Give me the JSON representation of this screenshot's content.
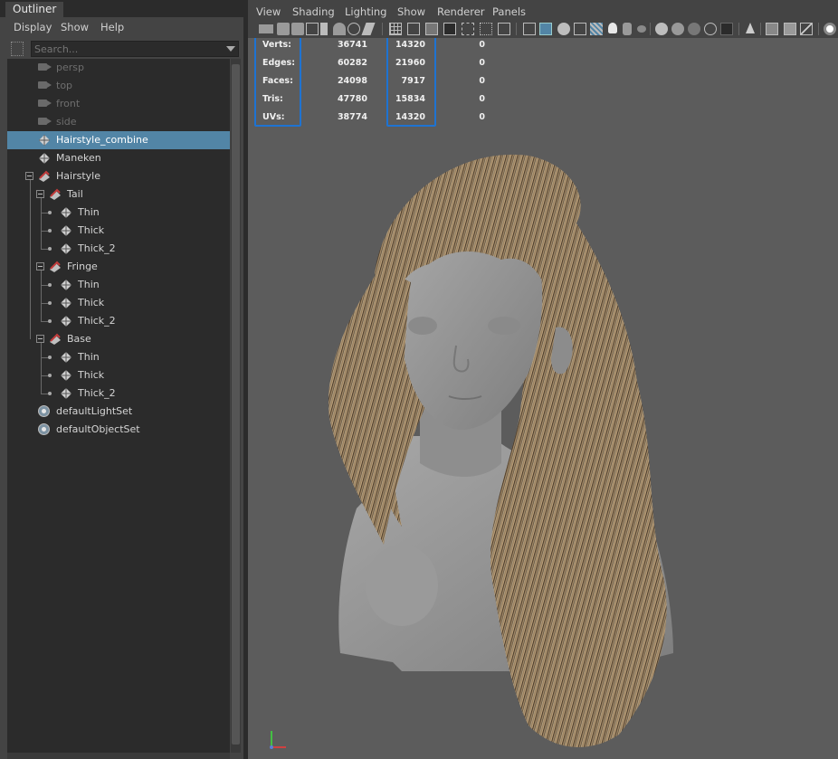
{
  "outliner": {
    "tab_title": "Outliner",
    "menu": [
      "Display",
      "Show",
      "Help"
    ],
    "search_placeholder": "Search...",
    "items": [
      {
        "label": "persp",
        "icon": "camera-icon",
        "dim": true
      },
      {
        "label": "top",
        "icon": "camera-icon",
        "dim": true
      },
      {
        "label": "front",
        "icon": "camera-icon",
        "dim": true
      },
      {
        "label": "side",
        "icon": "camera-icon",
        "dim": true
      },
      {
        "label": "Hairstyle_combine",
        "icon": "mesh-icon",
        "selected": true
      },
      {
        "label": "Maneken",
        "icon": "mesh-icon"
      },
      {
        "label": "Hairstyle",
        "icon": "group-icon"
      },
      {
        "label": "Tail",
        "icon": "group-icon"
      },
      {
        "label": "Thin",
        "icon": "mesh-icon"
      },
      {
        "label": "Thick",
        "icon": "mesh-icon"
      },
      {
        "label": "Thick_2",
        "icon": "mesh-icon"
      },
      {
        "label": "Fringe",
        "icon": "group-icon"
      },
      {
        "label": "Thin",
        "icon": "mesh-icon"
      },
      {
        "label": "Thick",
        "icon": "mesh-icon"
      },
      {
        "label": "Thick_2",
        "icon": "mesh-icon"
      },
      {
        "label": "Base",
        "icon": "group-icon"
      },
      {
        "label": "Thin",
        "icon": "mesh-icon"
      },
      {
        "label": "Thick",
        "icon": "mesh-icon"
      },
      {
        "label": "Thick_2",
        "icon": "mesh-icon"
      },
      {
        "label": "defaultLightSet",
        "icon": "set-icon"
      },
      {
        "label": "defaultObjectSet",
        "icon": "set-icon"
      }
    ]
  },
  "panel": {
    "menu": [
      "View",
      "Shading",
      "Lighting",
      "Show",
      "Renderer",
      "Panels"
    ],
    "hud": {
      "rows": [
        {
          "label": "Verts:",
          "object": "36741",
          "selected": "14320",
          "component": "0"
        },
        {
          "label": "Edges:",
          "object": "60282",
          "selected": "21960",
          "component": "0"
        },
        {
          "label": "Faces:",
          "object": "24098",
          "selected": "7917",
          "component": "0"
        },
        {
          "label": "Tris:",
          "object": "47780",
          "selected": "15834",
          "component": "0"
        },
        {
          "label": "UVs:",
          "object": "38774",
          "selected": "14320",
          "component": "0"
        }
      ]
    },
    "highlight_color": "#1e73d2"
  },
  "colors": {
    "selection": "#5285a6",
    "panel_bg": "#444444",
    "list_bg": "#2b2b2b",
    "viewport_bg": "#5c5c5c"
  }
}
